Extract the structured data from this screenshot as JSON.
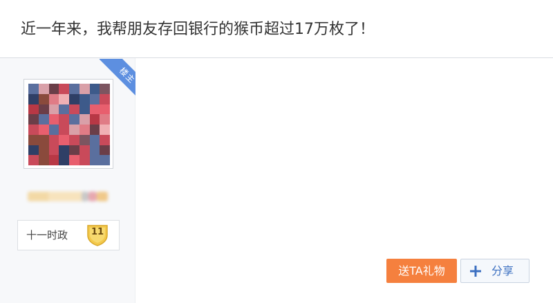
{
  "post": {
    "title": "近一年来，我帮朋友存回银行的猴币超过17万枚了！"
  },
  "author": {
    "badge": "楼主",
    "avatar_icon": "avatar-image-pixelated",
    "forum_level": {
      "title": "十一时政",
      "level": "11"
    }
  },
  "actions": {
    "gift_label": "送TA礼物",
    "share_label": "分享",
    "share_icon": "plus-icon"
  },
  "colors": {
    "badge_blue": "#5d8fe0",
    "gift_orange": "#f5803e",
    "share_text_blue": "#3b6fc1",
    "level_gold": "#f3c94c"
  }
}
